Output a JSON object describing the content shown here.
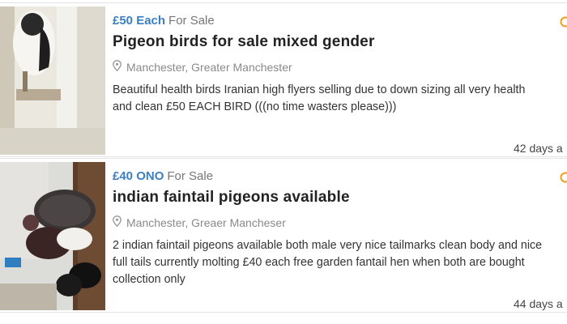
{
  "listings": [
    {
      "price": "£50 Each",
      "type": "For Sale",
      "title": "Pigeon birds for sale mixed gender",
      "location": "Manchester, Greater Manchester",
      "description": "Beautiful health birds Iranian high flyers selling due to down sizing all very health and clean £50 EACH BIRD (((no time wasters please)))",
      "age": "42 days a"
    },
    {
      "price": "£40 ONO",
      "type": "For Sale",
      "title": "indian faintail pigeons available",
      "location": "Manchester, Greaer Mancheser",
      "description": "2 indian faintail pigeons available both male very nice tailmarks clean body and nice full tails currently molting £40 each free garden fantail hen when both are bought collection only",
      "age": "44 days a"
    }
  ],
  "icons": {
    "location": "map-pin-icon",
    "favourite": "favourite-star-icon"
  },
  "colors": {
    "price": "#3a7fc2",
    "favourite": "#f0a020"
  }
}
